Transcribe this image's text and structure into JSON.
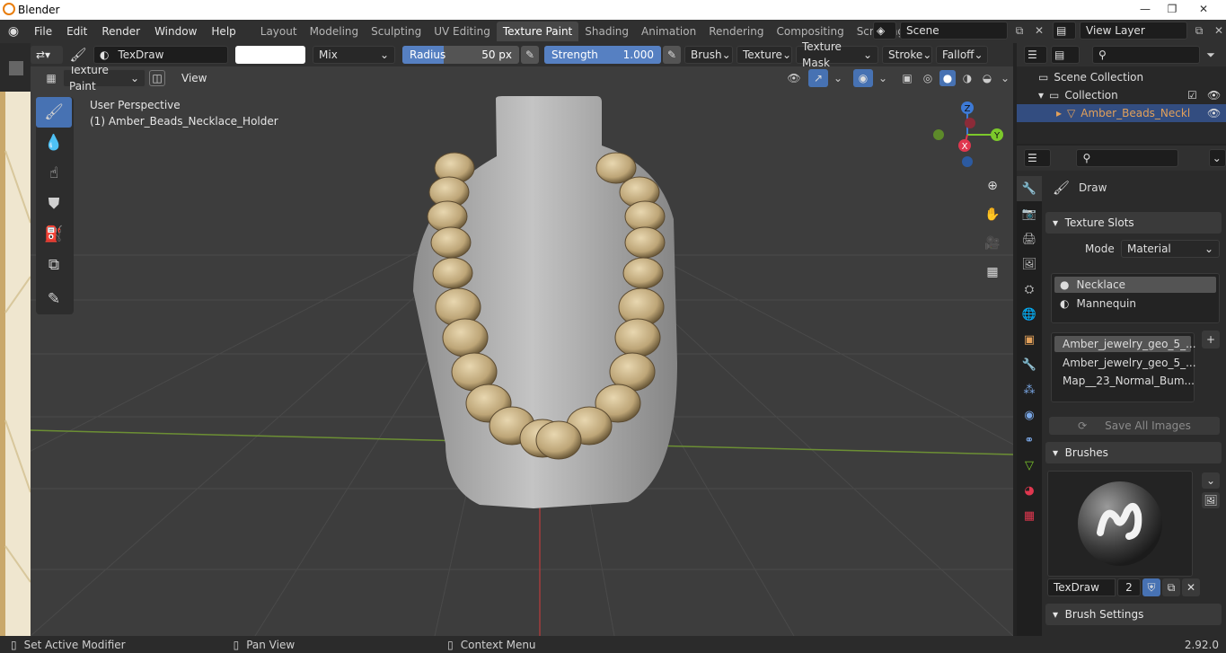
{
  "window": {
    "title": "Blender",
    "min": "—",
    "max": "❐",
    "close": "✕"
  },
  "menus": [
    "File",
    "Edit",
    "Render",
    "Window",
    "Help"
  ],
  "workspaces": [
    "Layout",
    "Modeling",
    "Sculpting",
    "UV Editing",
    "Texture Paint",
    "Shading",
    "Animation",
    "Rendering",
    "Compositing",
    "Scripting"
  ],
  "workspace_add": "+",
  "scene": {
    "label": "Scene",
    "view_layer": "View Layer"
  },
  "tool_header": {
    "brush_name": "TexDraw",
    "blend": "Mix",
    "radius_label": "Radius",
    "radius_value": "50 px",
    "radius_fraction": 0.35,
    "strength_label": "Strength",
    "strength_value": "1.000",
    "strength_fraction": 1.0,
    "brush": "Brush",
    "texture": "Texture",
    "texture_mask": "Texture Mask",
    "stroke": "Stroke",
    "falloff": "Falloff"
  },
  "viewport": {
    "mode": "Texture Paint",
    "view": "View",
    "perspective": "User Perspective",
    "object": "(1) Amber_Beads_Necklace_Holder"
  },
  "gizmo": {
    "x": "X",
    "y": "Y",
    "z": "Z"
  },
  "outliner": {
    "scene_collection": "Scene Collection",
    "collection": "Collection",
    "object": "Amber_Beads_Neckl"
  },
  "properties": {
    "tool": "Draw",
    "texture_slots": "Texture Slots",
    "mode_label": "Mode",
    "mode_value": "Material",
    "materials": [
      "Necklace",
      "Mannequin"
    ],
    "images": [
      "Amber_jewelry_geo_5_...",
      "Amber_jewelry_geo_5_...",
      "Map__23_Normal_Bum..."
    ],
    "save_all": "Save All Images",
    "brushes": "Brushes",
    "brush_name": "TexDraw",
    "brush_users": "2",
    "brush_settings": "Brush Settings"
  },
  "status": {
    "left": "Set Active Modifier",
    "middle": "Pan View",
    "right": "Context Menu",
    "version": "2.92.0"
  },
  "colors": {
    "accent": "#4772b3",
    "active_object": "#e2a05a",
    "x_axis": "#e0374f",
    "y_axis": "#7cc82b",
    "z_axis": "#3d7ad6"
  }
}
